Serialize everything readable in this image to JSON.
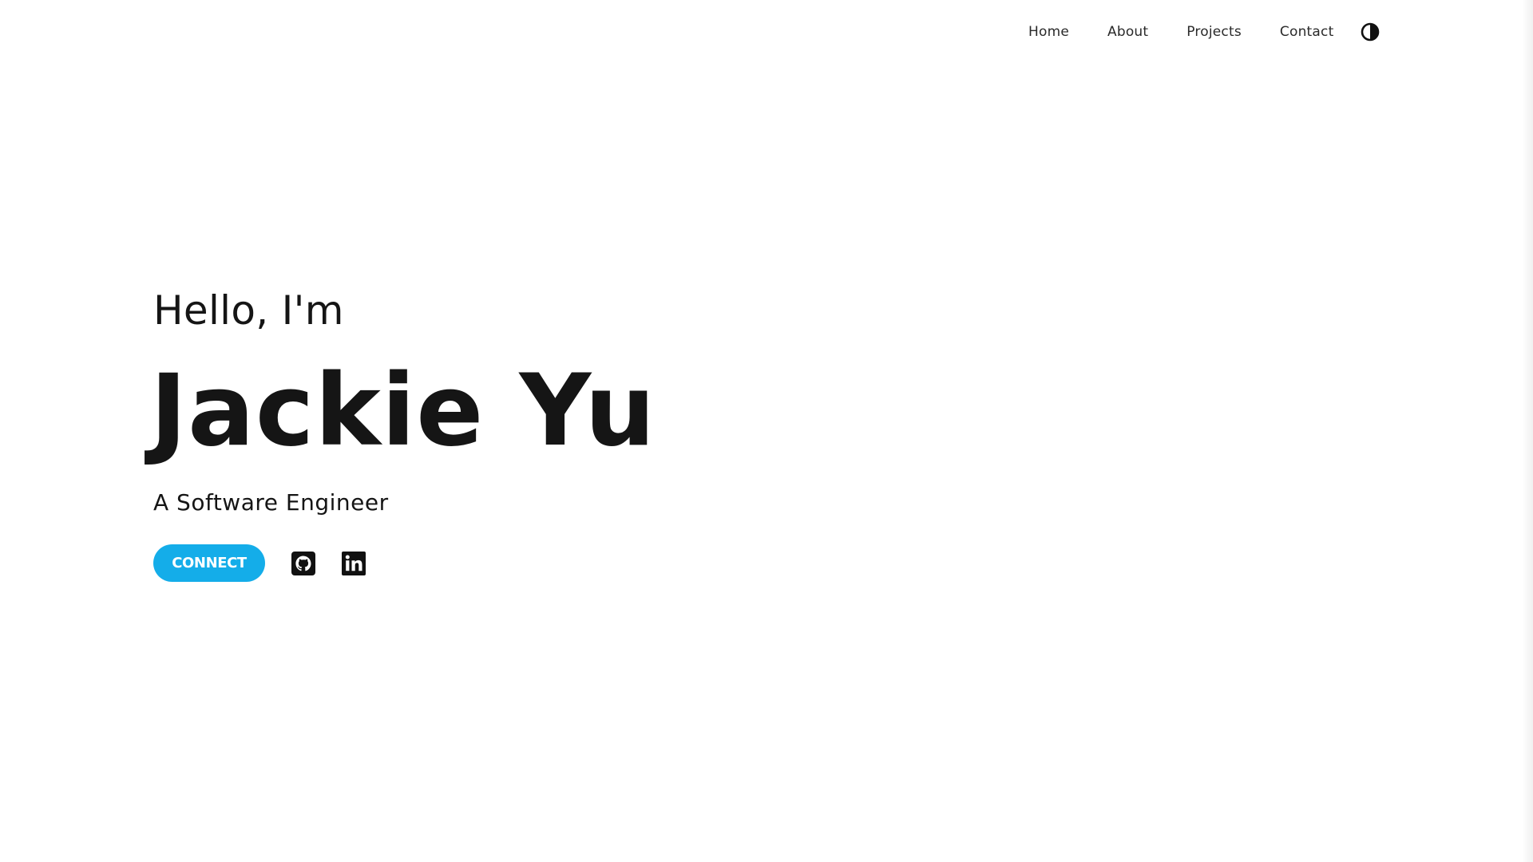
{
  "nav": {
    "items": [
      {
        "label": "Home"
      },
      {
        "label": "About"
      },
      {
        "label": "Projects"
      },
      {
        "label": "Contact"
      }
    ],
    "theme_toggle_icon": "contrast-toggle-icon"
  },
  "hero": {
    "greeting": "Hello, I'm",
    "name": "Jackie Yu",
    "subtitle": "A Software Engineer",
    "connect_label": "CONNECT",
    "social_icons": [
      "github-icon",
      "linkedin-icon"
    ]
  },
  "colors": {
    "accent": "#14ade9",
    "text": "#151515",
    "background": "#ffffff"
  }
}
